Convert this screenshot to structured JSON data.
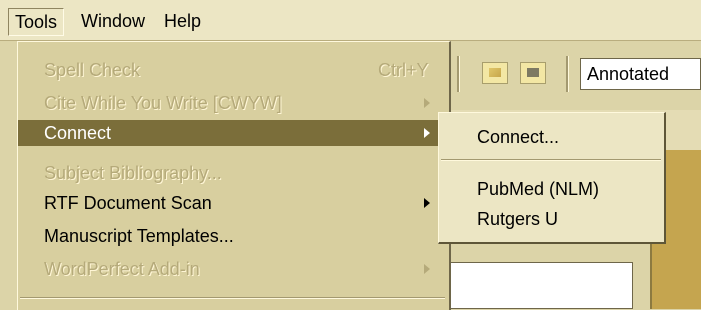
{
  "menubar": {
    "items": [
      {
        "label": "Tools"
      },
      {
        "label": "Window"
      },
      {
        "label": "Help"
      }
    ]
  },
  "toolbar": {
    "style_combo_value": "Annotated",
    "icons": [
      "image-icon",
      "frame-icon"
    ]
  },
  "tools_menu": {
    "items": [
      {
        "label": "Spell Check",
        "accelerator": "Ctrl+Y",
        "enabled": false,
        "submenu": false
      },
      {
        "label": "Cite While You Write [CWYW]",
        "accelerator": "",
        "enabled": false,
        "submenu": true
      },
      {
        "label": "Connect",
        "accelerator": "",
        "enabled": true,
        "submenu": true,
        "highlighted": true
      },
      {
        "label": "Subject Bibliography...",
        "accelerator": "",
        "enabled": false,
        "submenu": false
      },
      {
        "label": "RTF Document Scan",
        "accelerator": "",
        "enabled": true,
        "submenu": true
      },
      {
        "label": "Manuscript Templates...",
        "accelerator": "",
        "enabled": true,
        "submenu": false
      },
      {
        "label": "WordPerfect Add-in",
        "accelerator": "",
        "enabled": false,
        "submenu": true
      }
    ]
  },
  "connect_submenu": {
    "items": [
      {
        "label": "Connect..."
      },
      {
        "label": "PubMed (NLM)"
      },
      {
        "label": "Rutgers U"
      }
    ]
  },
  "colors": {
    "highlight": "#7b6e3a",
    "menu_bg": "#d8cf9f",
    "disabled_text": "#b5aa7a"
  }
}
